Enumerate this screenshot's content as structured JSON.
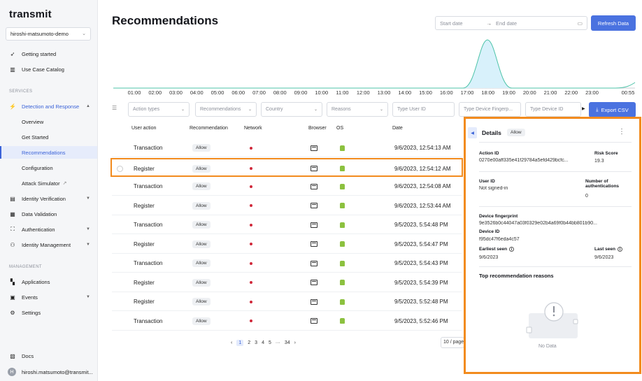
{
  "app": {
    "logo": "transmit"
  },
  "sidebar": {
    "tenant": "hiroshi-matsumoto-demo",
    "top_items": [
      {
        "label": "Getting started",
        "icon": "rocket-icon"
      },
      {
        "label": "Use Case Catalog",
        "icon": "book-icon"
      }
    ],
    "services_title": "SERVICES",
    "detection": {
      "label": "Detection and Response",
      "icon": "bolt-icon"
    },
    "detection_sub": [
      "Overview",
      "Get Started",
      "Recommendations",
      "Configuration",
      "Attack Simulator"
    ],
    "services_items": [
      {
        "label": "Identity Verification",
        "icon": "id-card-icon"
      },
      {
        "label": "Data Validation",
        "icon": "data-icon"
      },
      {
        "label": "Authentication",
        "icon": "scan-icon"
      },
      {
        "label": "Identity Management",
        "icon": "users-icon"
      }
    ],
    "management_title": "MANAGEMENT",
    "management_items": [
      {
        "label": "Applications",
        "icon": "apps-icon"
      },
      {
        "label": "Events",
        "icon": "calendar-icon"
      },
      {
        "label": "Settings",
        "icon": "gear-icon"
      }
    ],
    "docs": "Docs",
    "user": {
      "initial": "H",
      "email": "hiroshi.matsumoto@transmit..."
    }
  },
  "header": {
    "title": "Recommendations",
    "start_placeholder": "Start date",
    "end_placeholder": "End date",
    "refresh_label": "Refresh Data"
  },
  "timeline": {
    "ticks": [
      "01:00",
      "02:00",
      "03:00",
      "04:00",
      "05:00",
      "06:00",
      "07:00",
      "08:00",
      "09:00",
      "10:00",
      "11:00",
      "12:00",
      "13:00",
      "14:00",
      "15:00",
      "16:00",
      "17:00",
      "18:00",
      "19:00",
      "20:00",
      "21:00",
      "22:00",
      "23:00",
      "00:55"
    ],
    "peak_label": "18:00",
    "line_color": "#4cc3a8",
    "fill_color": "#d8f1fb"
  },
  "filters": {
    "action_types": "Action types",
    "recommendations": "Recommendations",
    "country": "Country",
    "reasons": "Reasons",
    "user_id": "Type User ID",
    "device_fp": "Type Device Fingerp...",
    "device_id": "Type Device ID",
    "export_label": "Export CSV"
  },
  "table": {
    "headers": [
      "User action",
      "Recommendation",
      "Network",
      "Browser",
      "OS",
      "Date"
    ],
    "rows": [
      {
        "action": "Transaction",
        "rec": "Allow",
        "date": "9/6/2023, 12:54:13 AM"
      },
      {
        "action": "Register",
        "rec": "Allow",
        "date": "9/6/2023, 12:54:12 AM"
      },
      {
        "action": "Transaction",
        "rec": "Allow",
        "date": "9/6/2023, 12:54:08 AM"
      },
      {
        "action": "Register",
        "rec": "Allow",
        "date": "9/6/2023, 12:53:44 AM"
      },
      {
        "action": "Transaction",
        "rec": "Allow",
        "date": "9/5/2023, 5:54:48 PM"
      },
      {
        "action": "Register",
        "rec": "Allow",
        "date": "9/5/2023, 5:54:47 PM"
      },
      {
        "action": "Transaction",
        "rec": "Allow",
        "date": "9/5/2023, 5:54:43 PM"
      },
      {
        "action": "Register",
        "rec": "Allow",
        "date": "9/5/2023, 5:54:39 PM"
      },
      {
        "action": "Register",
        "rec": "Allow",
        "date": "9/5/2023, 5:52:48 PM"
      },
      {
        "action": "Transaction",
        "rec": "Allow",
        "date": "9/5/2023, 5:52:46 PM"
      }
    ],
    "selected_index": 1
  },
  "pagination": {
    "prev": "‹",
    "pages": [
      "1",
      "2",
      "3",
      "4",
      "5",
      "···",
      "34"
    ],
    "next": "›",
    "current": "1",
    "per_page": "10 / page"
  },
  "details": {
    "title": "Details",
    "badge": "Allow",
    "action_id_label": "Action ID",
    "action_id": "0270e00aff335e41f29784a5efd429bcfc...",
    "risk_score_label": "Risk Score",
    "risk_score": "19.3",
    "user_id_label": "User ID",
    "user_id": "Not signed-in",
    "auth_count_label_1": "Number of",
    "auth_count_label_2": "authentications",
    "auth_count": "0",
    "device_fp_label": "Device fingerprint",
    "device_fp": "9e3526b0c44047a03f0329e02b4a69f0b44bb801b90...",
    "device_id_label": "Device ID",
    "device_id": "f95dc47f6eda4c57",
    "earliest_seen_label": "Earliest seen",
    "earliest_seen": "9/6/2023",
    "last_seen_label": "Last seen",
    "last_seen": "9/6/2023",
    "reasons_title": "Top recommendation reasons",
    "no_data": "No Data"
  },
  "colors": {
    "accent": "#4a72e0",
    "highlight": "#f28b1e",
    "network_dot": "#d0283a",
    "android": "#8cc13f"
  }
}
